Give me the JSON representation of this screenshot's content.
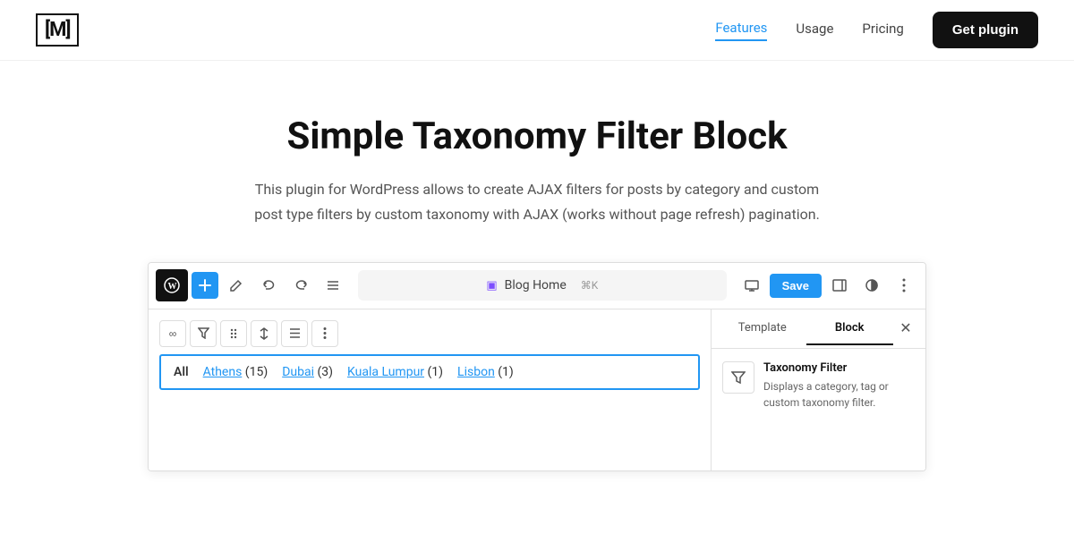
{
  "navbar": {
    "logo": "[M]",
    "links": [
      {
        "label": "Features",
        "active": true
      },
      {
        "label": "Usage",
        "active": false
      },
      {
        "label": "Pricing",
        "active": false
      }
    ],
    "cta_label": "Get plugin"
  },
  "hero": {
    "title": "Simple Taxonomy Filter Block",
    "description": "This plugin for WordPress allows to create AJAX filters for posts by category and custom post type filters by custom taxonomy with AJAX (works without page refresh) pagination."
  },
  "editor": {
    "wp_icon": "W",
    "toolbar": {
      "add_btn": "+",
      "pencil_btn": "✎",
      "undo_btn": "↩",
      "redo_btn": "↪",
      "list_btn": "≡",
      "url_label": "Blog Home",
      "cmd_hint": "⌘K",
      "save_label": "Save"
    },
    "block_toolbar": {
      "link_btn": "∞",
      "filter_btn": "⌥",
      "drag_btn": "⠿",
      "arrows_btn": "⇕",
      "align_btn": "≡",
      "more_btn": "⋮"
    },
    "filter_items": [
      {
        "label": "All",
        "count": null,
        "is_all": true
      },
      {
        "label": "Athens",
        "count": 15
      },
      {
        "label": "Dubai",
        "count": 3
      },
      {
        "label": "Kuala Lumpur",
        "count": 1
      },
      {
        "label": "Lisbon",
        "count": 1
      }
    ],
    "sidebar": {
      "tab_template": "Template",
      "tab_block": "Block",
      "active_tab": "Block",
      "block_name": "Taxonomy Filter",
      "block_desc": "Displays a category, tag or custom taxonomy filter.",
      "filter_icon": "⌥"
    }
  },
  "colors": {
    "active_nav": "#2196f3",
    "save_btn": "#2196f3",
    "filter_border": "#2196f3",
    "get_plugin_bg": "#111111"
  }
}
